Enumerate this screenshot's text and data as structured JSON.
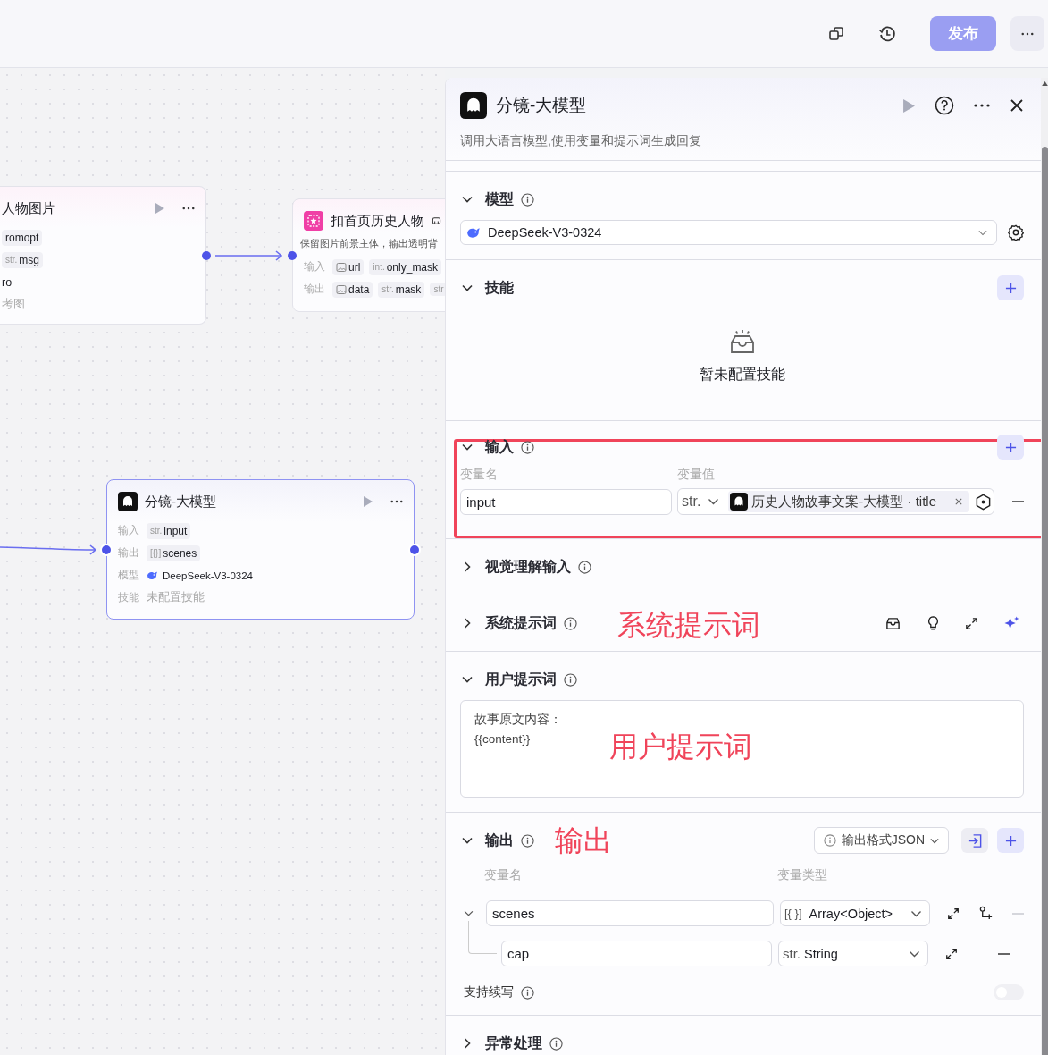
{
  "toolbar": {
    "publish_button": {
      "label": "发布",
      "disabled": true
    }
  },
  "canvas": {
    "nodes": [
      {
        "kind": "plain",
        "title": "人物图片",
        "selected": false,
        "rows": [
          {
            "items": [
              {
                "kind": "text",
                "name": "romopt"
              }
            ]
          },
          {
            "items": [
              {
                "kind": "text",
                "prefix": "str.",
                "name": "msg"
              }
            ]
          },
          {
            "text": "ro",
            "muted": false
          },
          {
            "text": "考图",
            "muted": true
          }
        ]
      },
      {
        "kind": "plugin",
        "title": "扣首页历史人物",
        "selected": false,
        "description": "保留图片前景主体，输出透明背",
        "rows": [
          {
            "label": "输入",
            "items": [
              {
                "kind": "image",
                "name": "url"
              },
              {
                "kind": "text",
                "prefix": "int.",
                "name": "only_mask"
              }
            ]
          },
          {
            "label": "输出",
            "items": [
              {
                "kind": "image",
                "name": "data"
              },
              {
                "kind": "text",
                "prefix": "str.",
                "name": "mask"
              },
              {
                "kind": "text",
                "prefix": "str"
              }
            ]
          }
        ]
      },
      {
        "kind": "llm",
        "title": "分镜-大模型",
        "selected": true,
        "rows": [
          {
            "label": "输入",
            "items": [
              {
                "kind": "text",
                "prefix": "str.",
                "name": "input"
              }
            ]
          },
          {
            "label": "输出",
            "items": [
              {
                "kind": "text",
                "prefix": "[{}]",
                "name": "scenes"
              }
            ]
          },
          {
            "label": "模型",
            "model": "DeepSeek-V3-0324"
          },
          {
            "label": "技能",
            "text": "未配置技能",
            "muted": true
          }
        ]
      }
    ]
  },
  "panel": {
    "title": "分镜-大模型",
    "description": "调用大语言模型,使用变量和提示词生成回复",
    "sections": [
      {
        "kind": "model",
        "title": "模型",
        "expanded": true,
        "info": true,
        "model": "DeepSeek-V3-0324"
      },
      {
        "kind": "skills",
        "title": "技能",
        "expanded": true,
        "empty_text": "暂未配置技能"
      },
      {
        "kind": "inputs",
        "title": "输入",
        "expanded": true,
        "info": true,
        "highlighted": true,
        "columns": [
          "变量名",
          "变量值"
        ],
        "rows": [
          {
            "name": "input",
            "type": "str.",
            "ref": "历史人物故事文案-大模型 · title"
          }
        ]
      },
      {
        "kind": "vision",
        "title": "视觉理解输入",
        "expanded": false,
        "info": true
      },
      {
        "kind": "system_prompt",
        "title": "系统提示词",
        "expanded": false,
        "info": true,
        "annotation": "系统提示词"
      },
      {
        "kind": "user_prompt",
        "title": "用户提示词",
        "expanded": true,
        "info": true,
        "text": "故事原文内容：\n{{content}}",
        "annotation": "用户提示词"
      },
      {
        "kind": "outputs",
        "title": "输出",
        "expanded": true,
        "info": true,
        "annotation": "输出",
        "format_button": "输出格式JSON",
        "columns": [
          "变量名",
          "变量类型"
        ],
        "rows": [
          {
            "name": "scenes",
            "type_prefix": "[{ }]",
            "type": "Array<Object>",
            "expanded": true,
            "children": [
              {
                "name": "cap",
                "type_prefix": "str.",
                "type": "String"
              }
            ]
          }
        ],
        "streaming": {
          "label": "支持续写",
          "on": false
        }
      },
      {
        "kind": "error",
        "title": "异常处理",
        "expanded": false,
        "info": true
      }
    ]
  }
}
